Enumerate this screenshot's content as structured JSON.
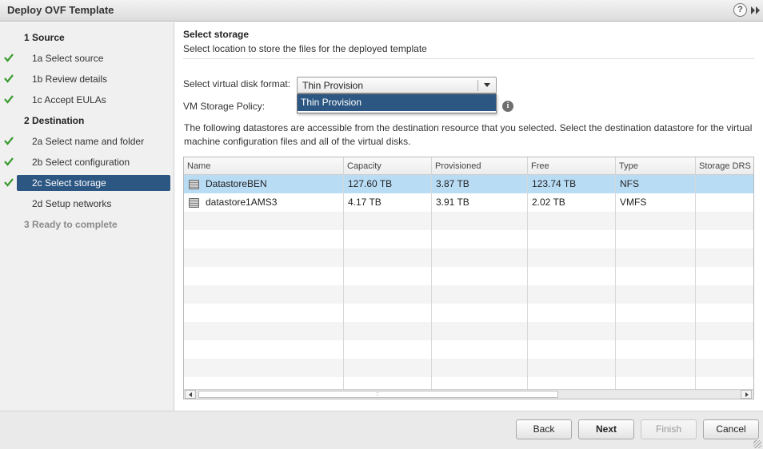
{
  "window": {
    "title": "Deploy OVF Template",
    "help_icon": "?"
  },
  "nav": {
    "items": [
      {
        "num": "1",
        "label": "Source",
        "type": "section",
        "done": false
      },
      {
        "num": "1a",
        "label": "Select source",
        "type": "step",
        "done": true
      },
      {
        "num": "1b",
        "label": "Review details",
        "type": "step",
        "done": true
      },
      {
        "num": "1c",
        "label": "Accept EULAs",
        "type": "step",
        "done": true
      },
      {
        "num": "2",
        "label": "Destination",
        "type": "section",
        "done": false
      },
      {
        "num": "2a",
        "label": "Select name and folder",
        "type": "step",
        "done": true
      },
      {
        "num": "2b",
        "label": "Select configuration",
        "type": "step",
        "done": true
      },
      {
        "num": "2c",
        "label": "Select storage",
        "type": "step",
        "done": true,
        "selected": true
      },
      {
        "num": "2d",
        "label": "Setup networks",
        "type": "step",
        "done": false
      },
      {
        "num": "3",
        "label": "Ready to complete",
        "type": "section",
        "done": false,
        "disabled": true
      }
    ],
    "labels": [
      "1  Source",
      "1a  Select source",
      "1b  Review details",
      "1c  Accept EULAs",
      "2  Destination",
      "2a  Select name and folder",
      "2b  Select configuration",
      "2c  Select storage",
      "2d  Setup networks",
      "3  Ready to complete"
    ],
    "check_color": "#3a9b2f",
    "selected_color": "#2c5783"
  },
  "main": {
    "heading": "Select storage",
    "subheading": "Select location to store the files for the deployed template",
    "disk_format_label": "Select virtual disk format:",
    "disk_format_value": "Thin Provision",
    "disk_format_option": "Thin Provision",
    "storage_policy_label": "VM Storage Policy:",
    "info_icon": "i",
    "description": "The following datastores are accessible from the destination resource that you selected. Select the destination datastore for the virtual machine configuration files and all of the virtual disks."
  },
  "grid": {
    "columns": [
      "Name",
      "Capacity",
      "Provisioned",
      "Free",
      "Type",
      "Storage DRS"
    ],
    "rows": [
      {
        "name": "DatastoreBEN",
        "capacity": "127.60 TB",
        "provisioned": "3.87 TB",
        "free": "123.74 TB",
        "type": "NFS",
        "storage_drs": ""
      },
      {
        "name": "datastore1AMS3",
        "capacity": "4.17 TB",
        "provisioned": "3.91 TB",
        "free": "2.02 TB",
        "type": "VMFS",
        "storage_drs": ""
      }
    ],
    "selected_row_color": "#b9dcf5",
    "scroll_grip": "::"
  },
  "footer": {
    "back": "Back",
    "next": "Next",
    "finish": "Finish",
    "cancel": "Cancel"
  }
}
